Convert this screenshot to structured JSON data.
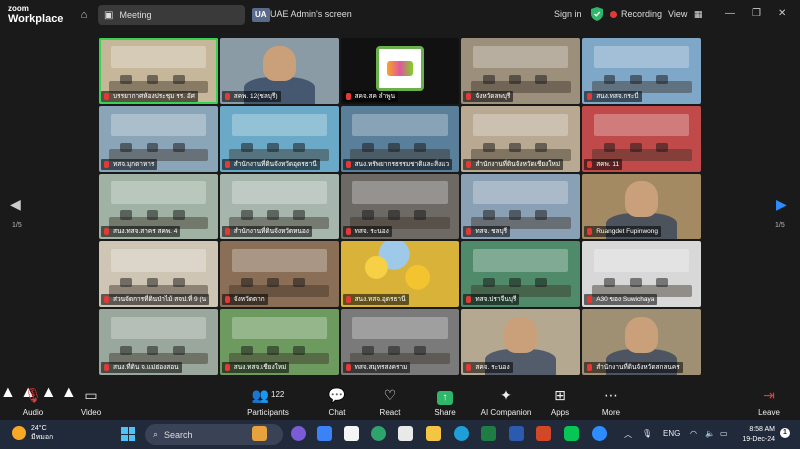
{
  "app": {
    "brand_line1": "zoom",
    "brand_line2": "Workplace",
    "meeting_label": "Meeting",
    "screen_badge": "UA",
    "screen_name": "UAE Admin's screen",
    "signin": "Sign in",
    "recording": "Recording",
    "view": "View"
  },
  "gallery": {
    "page_left": "1/5",
    "page_right": "1/5",
    "tiles": [
      {
        "name": "บรรยากาศห้องประชุม รร. อัศ",
        "active": true,
        "bg": "#c7b79a",
        "scene": "room"
      },
      {
        "name": "สคพ. 12(ชลบุรี)",
        "bg": "#8a9ba6",
        "scene": "person"
      },
      {
        "name": "สคจ.สค ลำพูน",
        "bg": "#111111",
        "scene": "logo"
      },
      {
        "name": "จังหวัดลพบุรี",
        "bg": "#9c8f7c",
        "scene": "room"
      },
      {
        "name": "สนง.ทสจ.กระบี่",
        "bg": "#7fa7c8",
        "scene": "room"
      },
      {
        "name": "ทสจ.มุกดาหาร",
        "bg": "#8aa5b8",
        "scene": "room"
      },
      {
        "name": "สำนักงานที่ดินจังหวัดอุดรธานี",
        "bg": "#6aa9c7",
        "scene": "room"
      },
      {
        "name": "สนง.ทรัพยากรธรรมชาติและสิ่งแว",
        "bg": "#5a7f9a",
        "scene": "room"
      },
      {
        "name": "สำนักงานที่ดินจังหวัดเชียงใหม่",
        "bg": "#b9a993",
        "scene": "room"
      },
      {
        "name": "สคพ. 11",
        "bg": "#c04a4a",
        "scene": "room"
      },
      {
        "name": "สนง.ทสจ.สาคร สคพ. 4",
        "bg": "#9fb2a4",
        "scene": "room"
      },
      {
        "name": "สำนักงานที่ดินจังหวัดหนอง",
        "bg": "#a7b6ad",
        "scene": "room"
      },
      {
        "name": "ทสจ. ระนอง",
        "bg": "#6d6a66",
        "scene": "room"
      },
      {
        "name": "ทสจ. ชลบุรี",
        "bg": "#8aa0b4",
        "scene": "room"
      },
      {
        "name": "Ruangdet Fupinwong",
        "bg": "#a48a62",
        "scene": "person"
      },
      {
        "name": "ส่วนจัดการที่ดินป่าไม้ สจป.ที่ 9 (น",
        "bg": "#cfc5b5",
        "scene": "room"
      },
      {
        "name": "จังหวัดตาก",
        "bg": "#8a6e55",
        "scene": "room"
      },
      {
        "name": "สนง.ทสจ.อุดรธานี",
        "bg": "#d9b23a",
        "scene": "flowers"
      },
      {
        "name": "ทสจ.ปราจีนบุรี",
        "bg": "#4f8a6a",
        "scene": "room"
      },
      {
        "name": "A30 ของ Suwichaya",
        "bg": "#d8d8d8",
        "scene": "room"
      },
      {
        "name": "สนง.ที่ดิน จ.แม่ฮ่องสอน",
        "bg": "#9aa79c",
        "scene": "room"
      },
      {
        "name": "สนง.ทสจ.เชียงใหม่",
        "bg": "#6d9a5f",
        "scene": "room"
      },
      {
        "name": "ทสจ.สมุทรสงคราม",
        "bg": "#7a7a7a",
        "scene": "room"
      },
      {
        "name": "สคจ. ระนอง",
        "bg": "#b5a891",
        "scene": "person"
      },
      {
        "name": "สำนักงานที่ดินจังหวัดสกลนคร",
        "bg": "#a09073",
        "scene": "person"
      }
    ]
  },
  "toolbar": {
    "audio": "Audio",
    "video": "Video",
    "participants": "Participants",
    "participant_count": "122",
    "chat": "Chat",
    "react": "React",
    "share": "Share",
    "ai": "AI Companion",
    "apps": "Apps",
    "more": "More",
    "leave": "Leave"
  },
  "taskbar": {
    "temp": "24°C",
    "weather_text": "มีหมอก",
    "search": "Search",
    "lang": "ENG",
    "time": "8:58 AM",
    "date": "19-Dec-24",
    "notif_count": "1"
  }
}
